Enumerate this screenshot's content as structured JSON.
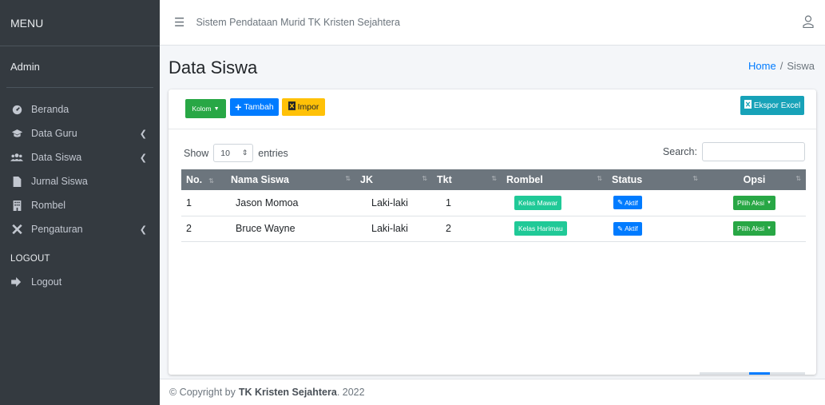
{
  "sidebar": {
    "brand": "MENU",
    "user": "Admin",
    "items": [
      {
        "label": "Beranda",
        "icon": "dashboard-icon",
        "has_children": false
      },
      {
        "label": "Data Guru",
        "icon": "graduation-cap-icon",
        "has_children": true
      },
      {
        "label": "Data Siswa",
        "icon": "users-icon",
        "has_children": true
      },
      {
        "label": "Jurnal Siswa",
        "icon": "file-icon",
        "has_children": false
      },
      {
        "label": "Rombel",
        "icon": "building-icon",
        "has_children": false
      },
      {
        "label": "Pengaturan",
        "icon": "tools-icon",
        "has_children": true
      }
    ],
    "section_header": "LOGOUT",
    "logout_label": "Logout"
  },
  "topbar": {
    "title": "Sistem Pendataan Murid TK Kristen Sejahtera"
  },
  "page": {
    "title": "Data Siswa",
    "breadcrumb": {
      "home": "Home",
      "separator": "/",
      "current": "Siswa"
    }
  },
  "toolbar": {
    "kolom_label": "Kolom",
    "tambah_label": "Tambah",
    "impor_label": "Impor",
    "ekspor_label": "Ekspor Excel"
  },
  "table_controls": {
    "show_label": "Show",
    "entries_value": "10",
    "entries_label": "entries",
    "search_label": "Search:",
    "search_value": ""
  },
  "table": {
    "headers": [
      "No.",
      "Nama Siswa",
      "JK",
      "Tkt",
      "Rombel",
      "Status",
      "Opsi"
    ],
    "rows": [
      {
        "no": "1",
        "nama": "Jason Momoa",
        "jk": "Laki-laki",
        "tkt": "1",
        "rombel": "Kelas Mawar",
        "status": "Aktif",
        "opsi": "Pilih Aksi"
      },
      {
        "no": "2",
        "nama": "Bruce Wayne",
        "jk": "Laki-laki",
        "tkt": "2",
        "rombel": "Kelas Harimau",
        "status": "Aktif",
        "opsi": "Pilih Aksi"
      }
    ]
  },
  "footer": {
    "prefix": "© Copyright by",
    "brand": "TK Kristen Sejahtera",
    "suffix": ". 2022"
  },
  "colors": {
    "sidebar_bg": "#343a40",
    "primary": "#007bff",
    "success": "#28a745",
    "warning": "#ffc107",
    "info": "#17a2b8",
    "table_header": "#6c757d"
  }
}
